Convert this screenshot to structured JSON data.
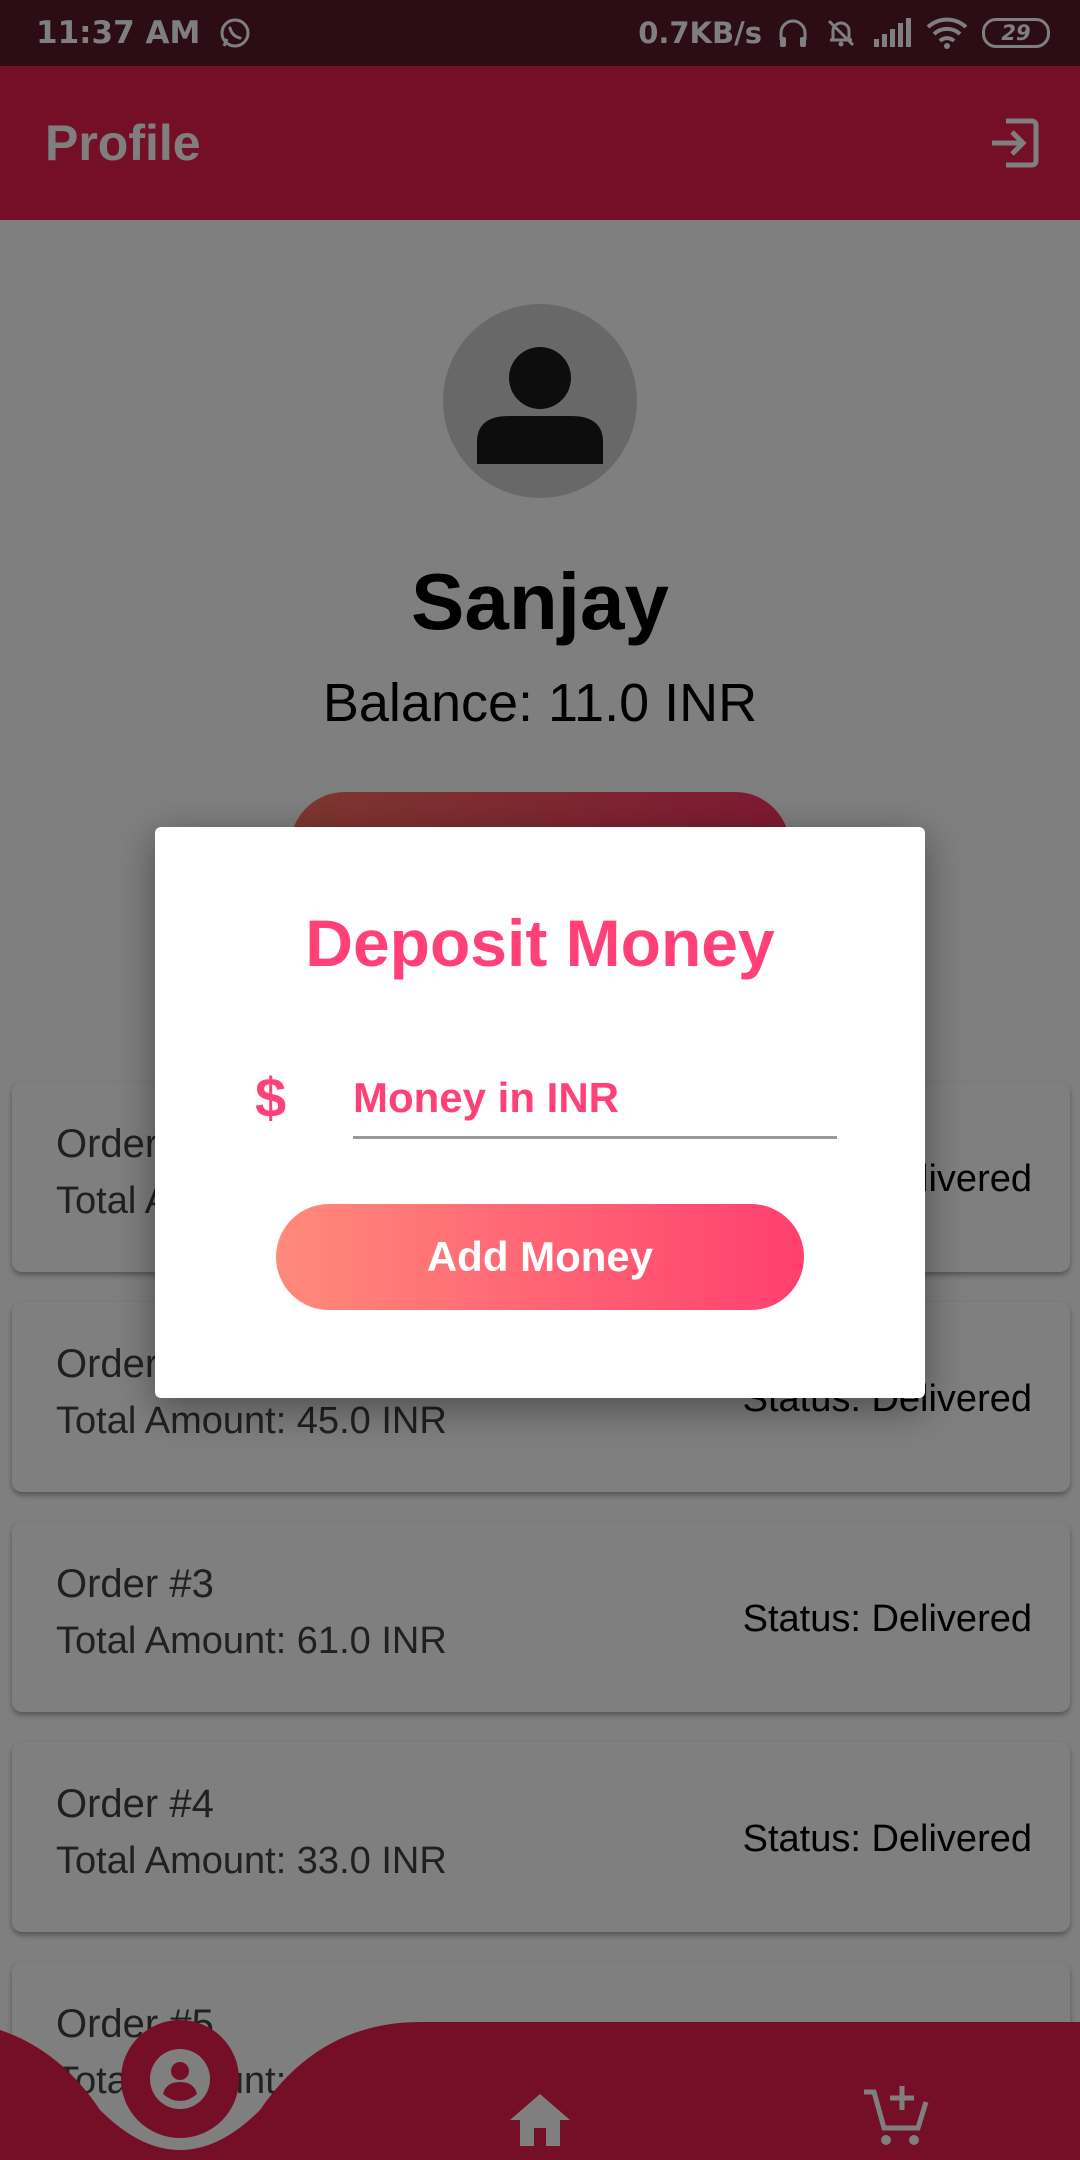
{
  "status_bar": {
    "time": "11:37 AM",
    "net_speed": "0.7KB/s",
    "battery": "29",
    "icons": [
      "whatsapp-icon",
      "headset-icon",
      "bell-off-icon",
      "signal-icon",
      "wifi-icon"
    ]
  },
  "app_bar": {
    "title": "Profile",
    "action_icon": "logout-icon"
  },
  "profile": {
    "name": "Sanjay",
    "balance": "Balance: 11.0 INR"
  },
  "orders": [
    {
      "title": "Order #1",
      "amount": "Total Amount: ",
      "status": "Status: Delivered"
    },
    {
      "title": "Order #2",
      "amount": "Total Amount: 45.0 INR",
      "status": "Status: Delivered"
    },
    {
      "title": "Order #3",
      "amount": "Total Amount: 61.0 INR",
      "status": "Status: Delivered"
    },
    {
      "title": "Order #4",
      "amount": "Total Amount: 33.0 INR",
      "status": "Status: Delivered"
    },
    {
      "title": "Order #5",
      "amount": "Total Amount: ",
      "status": ""
    }
  ],
  "dialog": {
    "title": "Deposit Money",
    "input_icon": "$",
    "input_placeholder": "Money in INR",
    "input_value": "",
    "button_label": "Add Money"
  },
  "bottom_nav": {
    "items": [
      "profile-icon",
      "home-icon",
      "cart-add-icon"
    ],
    "active": "profile-icon"
  },
  "colors": {
    "primary": "#e91e4f",
    "status_bar": "#58182b",
    "accent_text": "#ff4178",
    "gradient_start": "#ff8a7a",
    "gradient_end": "#ff3f6e"
  }
}
